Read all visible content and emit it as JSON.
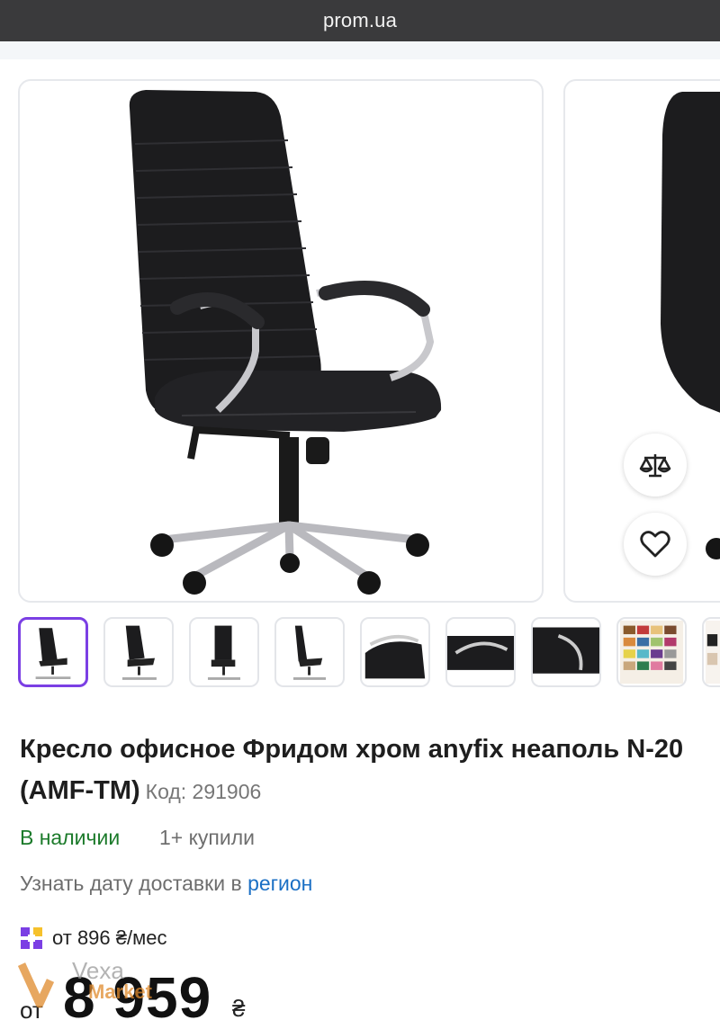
{
  "browser": {
    "url": "prom.ua"
  },
  "product": {
    "title": "Кресло офисное Фридом хром anyfix неаполь N-20 (AMF-TM)",
    "code": "Код: 291906",
    "availability": "В наличии",
    "bought": "1+ купили",
    "delivery_text": "Узнать дату доставки в",
    "delivery_link": "регион",
    "installment_text": "от 896 ₴/мес",
    "price_prefix": "от",
    "price": "8 959",
    "currency": "₴"
  },
  "gallery": {
    "thumbnail_count": 9,
    "active_index": 0,
    "compare_icon": "scale-icon",
    "wishlist_icon": "heart-icon"
  },
  "watermark": {
    "line1": "Vexa",
    "line2": "Market"
  },
  "colors": {
    "accent_purple": "#7b3fe4",
    "in_stock_green": "#1b7a2a",
    "link_blue": "#1a6fc4",
    "browser_bar": "#3a3a3c"
  }
}
